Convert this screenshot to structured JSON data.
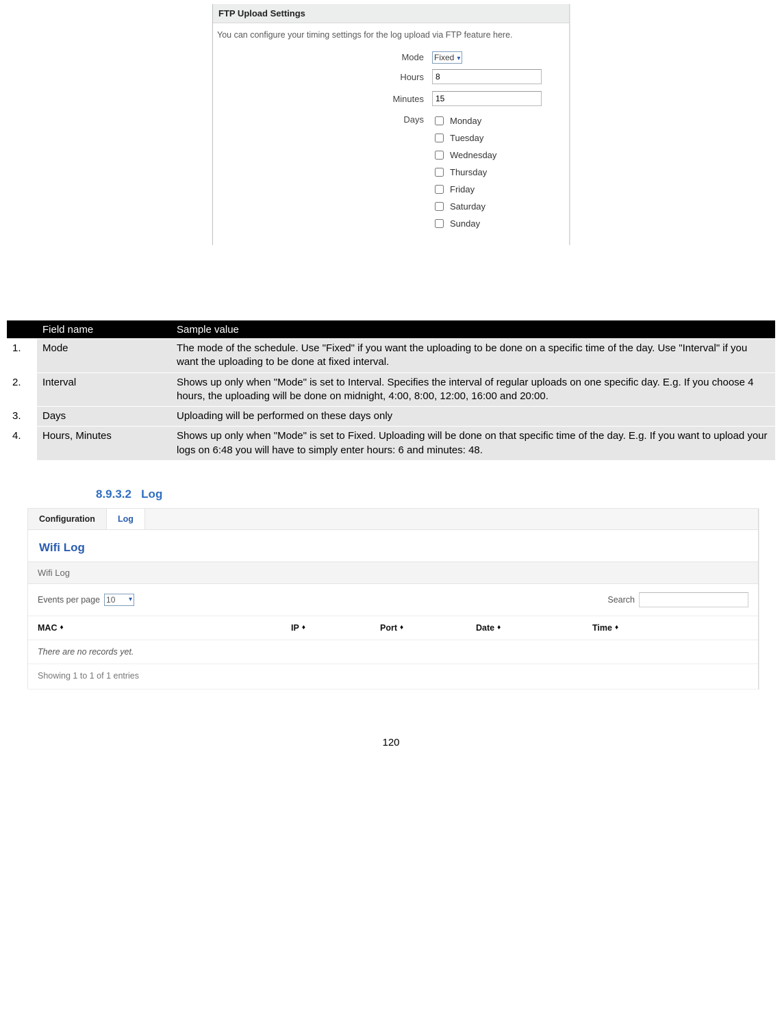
{
  "ftp": {
    "header": "FTP Upload Settings",
    "desc": "You can configure your timing settings for the log upload via FTP feature here.",
    "labels": {
      "mode": "Mode",
      "hours": "Hours",
      "minutes": "Minutes",
      "days": "Days"
    },
    "values": {
      "mode": "Fixed",
      "hours": "8",
      "minutes": "15"
    },
    "day_names": [
      "Monday",
      "Tuesday",
      "Wednesday",
      "Thursday",
      "Friday",
      "Saturday",
      "Sunday"
    ]
  },
  "desc_table": {
    "head": {
      "idx": "",
      "field": "Field name",
      "desc": "Sample value"
    },
    "rows": [
      {
        "n": "1.",
        "field": "Mode",
        "desc": "The mode of the schedule. Use \"Fixed\" if you want the uploading to be done on a specific time of the day. Use \"Interval\" if you want the uploading to be done at fixed interval."
      },
      {
        "n": "2.",
        "field": "Interval",
        "desc": "Shows up only when \"Mode\" is set to Interval. Specifies the interval of regular uploads on one specific day. E.g. If you choose 4 hours, the uploading will be done on midnight, 4:00, 8:00, 12:00, 16:00 and 20:00."
      },
      {
        "n": "3.",
        "field": "Days",
        "desc": "Uploading will be performed on these days only"
      },
      {
        "n": "4.",
        "field": "Hours, Minutes",
        "desc": "Shows up only when \"Mode\" is set to Fixed. Uploading will be done on that specific time of the day. E.g. If you want to upload your logs on 6:48 you will have to simply enter hours: 6 and minutes: 48."
      }
    ]
  },
  "section": {
    "num": "8.9.3.2",
    "title": "Log"
  },
  "log": {
    "tabs": {
      "config": "Configuration",
      "log": "Log"
    },
    "title": "Wifi Log",
    "subtitle": "Wifi Log",
    "events_label": "Events per page",
    "events_value": "10",
    "search_label": "Search",
    "search_value": "",
    "columns": {
      "mac": "MAC",
      "ip": "IP",
      "port": "Port",
      "date": "Date",
      "time": "Time"
    },
    "empty": "There are no records yet.",
    "footer": "Showing 1 to 1 of 1 entries"
  },
  "page_number": "120"
}
